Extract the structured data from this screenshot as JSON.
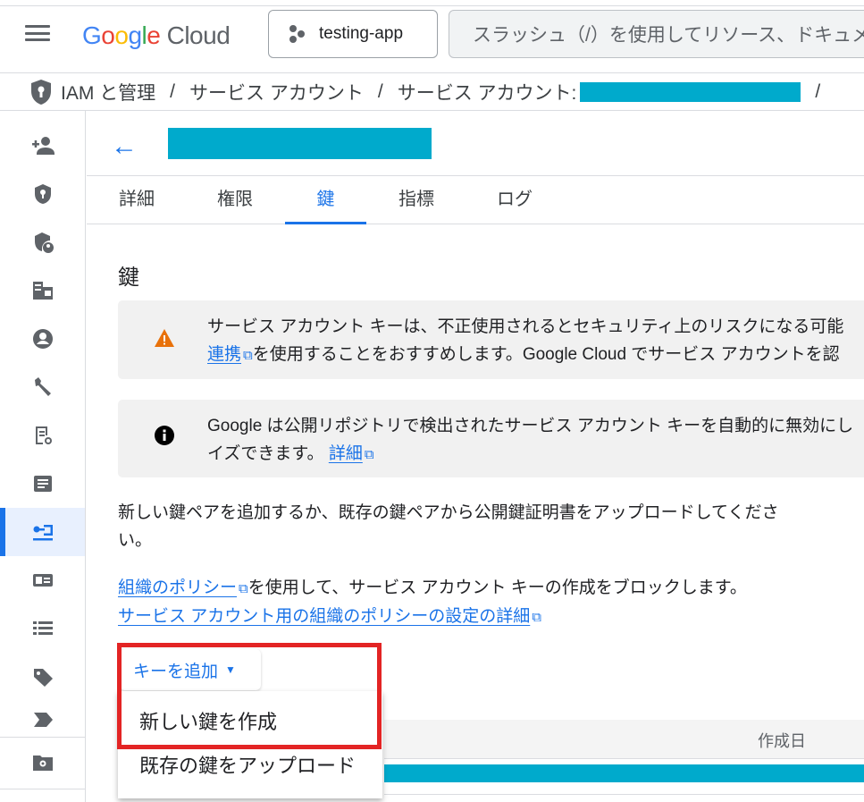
{
  "header": {
    "logo_google": "Google",
    "logo_cloud": "Cloud",
    "project": "testing-app",
    "search_placeholder": "スラッシュ（/）を使用してリソース、ドキュメント、プロダクトなどを検索"
  },
  "breadcrumb": {
    "items": [
      "IAM と管理",
      "サービス アカウント",
      "サービス アカウント: "
    ],
    "separator": "/"
  },
  "colors": {
    "redaction": "#00aacc",
    "accent": "#1a73e8",
    "highlight": "#e32424",
    "warning": "#e8710a"
  },
  "tabs": [
    "詳細",
    "権限",
    "鍵",
    "指標",
    "ログ"
  ],
  "active_tab": "鍵",
  "section_title": "鍵",
  "warning": {
    "line1": "サービス アカウント キーは、不正使用されるとセキュリティ上のリスクになる可能",
    "link": "連携",
    "line2": "を使用することをおすすめします。Google Cloud でサービス アカウントを認"
  },
  "info": {
    "line1": "Google は公開リポジトリで検出されたサービス アカウント キーを自動的に無効にし",
    "line2": "イズできます。",
    "link": "詳細"
  },
  "description": {
    "line1": "新しい鍵ペアを追加するか、既存の鍵ペアから公開鍵証明書をアップロードしてくださ",
    "line2": "い。"
  },
  "policy": {
    "link1": "組織のポリシー",
    "text1": "を使用して、サービス アカウント キーの作成をブロックします。",
    "link2": "サービス アカウント用の組織のポリシーの設定の詳細"
  },
  "add_key_button": "キーを追加",
  "dropdown": [
    "新しい鍵を作成",
    "既存の鍵をアップロード"
  ],
  "table": {
    "created_header": "作成日"
  }
}
